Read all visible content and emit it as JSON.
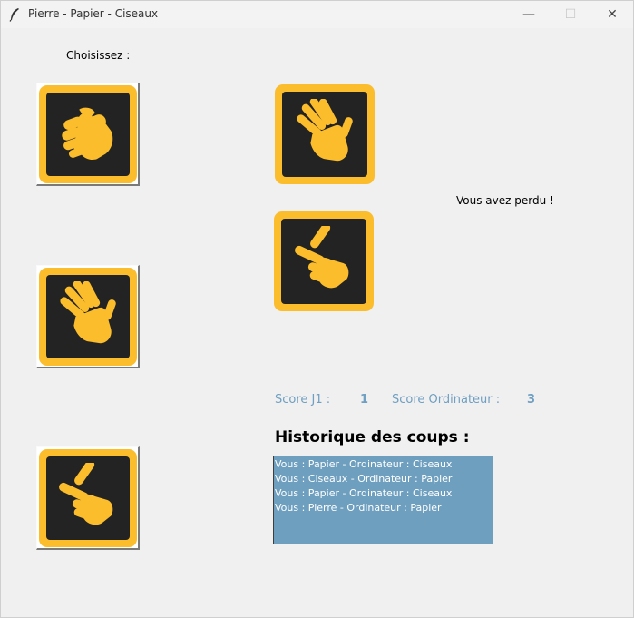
{
  "window": {
    "title": "Pierre - Papier - Ciseaux",
    "minimize": "—",
    "maximize": "☐",
    "close": "✕"
  },
  "choices": {
    "label": "Choisissez :",
    "buttons": [
      {
        "name": "rock-button",
        "icon": "rock-fist-icon"
      },
      {
        "name": "paper-button",
        "icon": "paper-hand-icon"
      },
      {
        "name": "scissors-button",
        "icon": "scissors-hand-icon"
      }
    ]
  },
  "result": {
    "player_choice_icon": "paper-hand-icon",
    "computer_choice_icon": "scissors-hand-icon",
    "message": "Vous avez perdu !"
  },
  "score": {
    "player_label": "Score J1 :",
    "player_value": "1",
    "computer_label": "Score Ordinateur :",
    "computer_value": "3"
  },
  "history": {
    "title": "Historique des coups :",
    "entries": [
      "Vous : Papier - Ordinateur : Ciseaux",
      "Vous : Ciseaux - Ordinateur : Papier",
      "Vous : Papier - Ordinateur : Ciseaux",
      "Vous : Pierre - Ordinateur : Papier"
    ]
  },
  "colors": {
    "tile_yellow": "#fbbd2c",
    "tile_dark": "#232323",
    "score_blue": "#6f9fc2",
    "history_bg": "#6f9fbf"
  }
}
